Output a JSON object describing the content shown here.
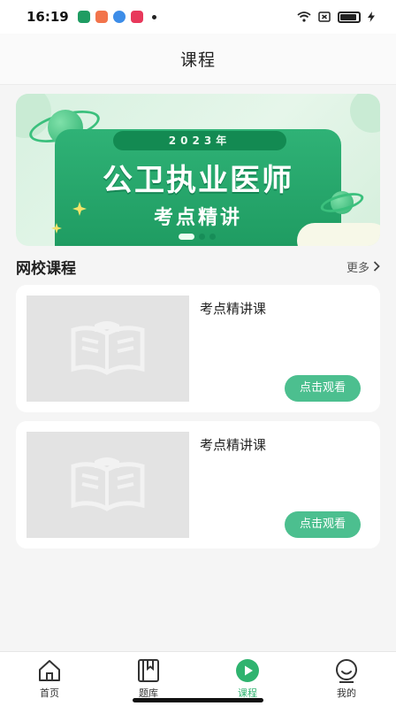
{
  "status_bar": {
    "time": "16:19"
  },
  "header": {
    "title": "课程"
  },
  "banner": {
    "year": "2023年",
    "title": "公卫执业医师",
    "subtitle": "考点精讲"
  },
  "section": {
    "title": "网校课程",
    "more_label": "更多"
  },
  "courses": [
    {
      "title": "考点精讲课",
      "button": "点击观看"
    },
    {
      "title": "考点精讲课",
      "button": "点击观看"
    }
  ],
  "tabbar": {
    "items": [
      {
        "label": "首页",
        "icon": "home-icon"
      },
      {
        "label": "题库",
        "icon": "bookmark-book-icon"
      },
      {
        "label": "课程",
        "icon": "play-circle-icon"
      },
      {
        "label": "我的",
        "icon": "smile-user-icon"
      }
    ],
    "active_index": 2,
    "active_color": "#2fb36f"
  },
  "colors": {
    "accent": "#4cbf8f",
    "banner_green": "#2fb276"
  }
}
